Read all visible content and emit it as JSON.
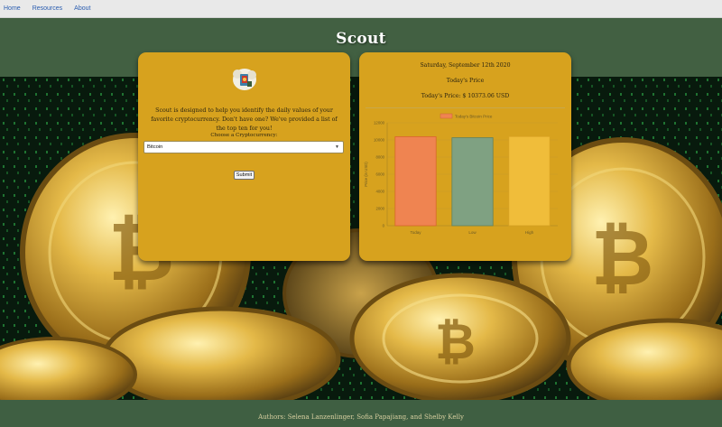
{
  "nav": {
    "items": [
      {
        "label": "Home"
      },
      {
        "label": "Resources"
      },
      {
        "label": "About"
      }
    ]
  },
  "app": {
    "title": "Scout"
  },
  "form": {
    "intro": "Scout is designed to help you identify the daily values of your favorite cryptocurrency. Don't have one? We've provided a list of the top ten for you!",
    "choose_label": "Choose a Cryptocurrency:",
    "selected": "Bitcoin",
    "submit_label": "Submit"
  },
  "price": {
    "date": "Saturday, September 12th 2020",
    "heading": "Today's Price",
    "price_text": "Today's Price: $ 10373.06 USD"
  },
  "chart_data": {
    "type": "bar",
    "categories": [
      "Today",
      "Low",
      "High"
    ],
    "series": [
      {
        "name": "Today's Bitcoin Price",
        "values": [
          10373.06,
          10260,
          10400
        ]
      }
    ],
    "bar_colors": [
      "#ef8451",
      "#7fa182",
      "#f0bd3a"
    ],
    "ylabel": "Price (in USD)",
    "yticks": [
      0,
      2000,
      4000,
      6000,
      8000,
      10000,
      12000
    ],
    "ylim": [
      0,
      12000
    ],
    "legend": "top",
    "grid": true
  },
  "footer": {
    "authors": "Authors: Selena Lanzenlinger, Sofia Papajiang, and Shelby Kelly"
  },
  "colors": {
    "header": "#426042",
    "card": "#d7a21e",
    "nav_link": "#2a5db0"
  }
}
